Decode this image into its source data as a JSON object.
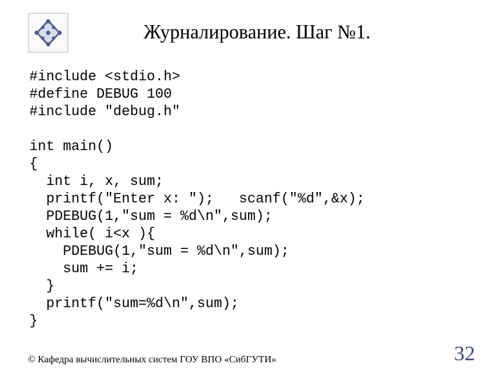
{
  "title": "Журналирование. Шаг №1.",
  "code": "#include <stdio.h>\n#define DEBUG 100\n#include \"debug.h\"\n\nint main()\n{\n  int i, x, sum;\n  printf(\"Enter x: \");   scanf(\"%d\",&x);\n  PDEBUG(1,\"sum = %d\\n\",sum);\n  while( i<x ){\n    PDEBUG(1,\"sum = %d\\n\",sum);\n    sum += i;\n  }\n  printf(\"sum=%d\\n\",sum);\n}",
  "copyright": "© Кафедра вычислительных систем ГОУ ВПО «СибГУТИ»",
  "page_number": "32"
}
